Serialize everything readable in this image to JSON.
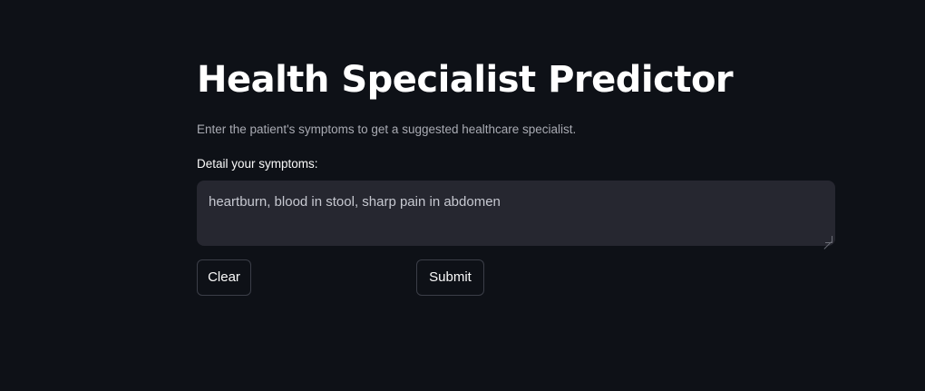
{
  "page": {
    "title": "Health Specialist Predictor",
    "subtitle": "Enter the patient's symptoms to get a suggested healthcare specialist."
  },
  "form": {
    "symptoms_label": "Detail your symptoms:",
    "symptoms_value": "heartburn, blood in stool, sharp pain in abdomen",
    "clear_label": "Clear",
    "submit_label": "Submit"
  },
  "colors": {
    "background": "#0e1117",
    "input_background": "#262730",
    "text": "#fafafa",
    "muted_text": "#a9abb3",
    "button_border": "#3b3e48"
  }
}
